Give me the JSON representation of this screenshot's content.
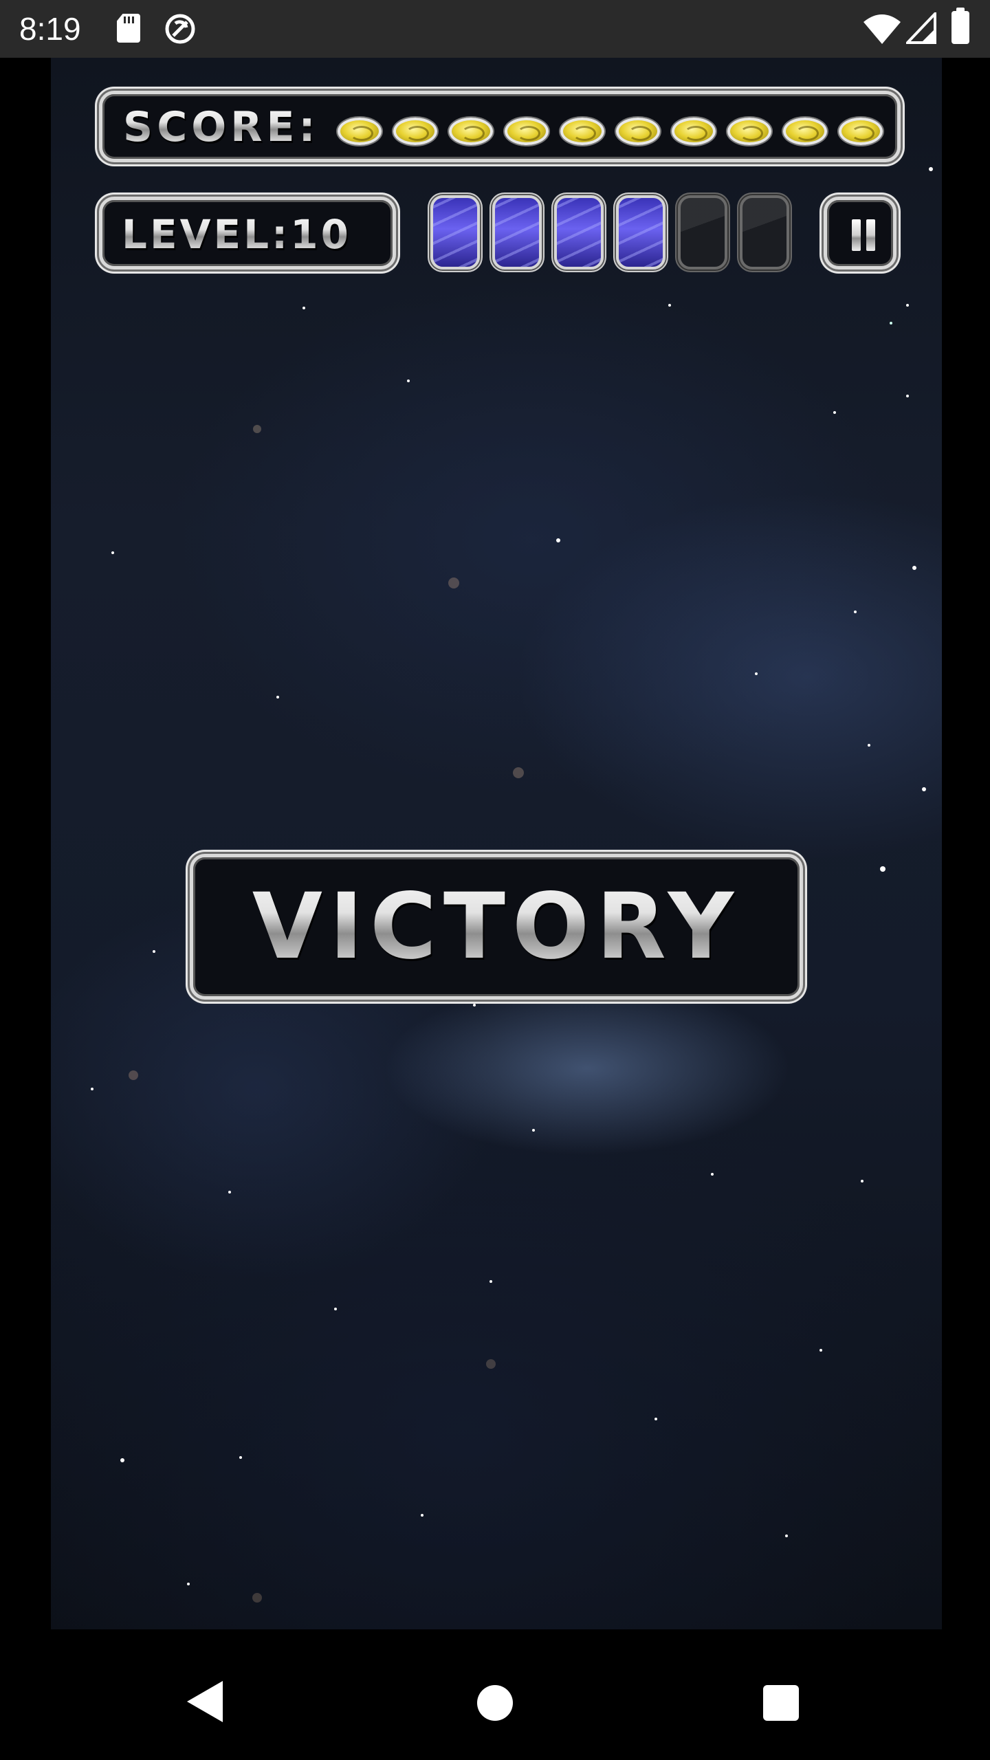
{
  "status_bar": {
    "time": "8:19",
    "icons": [
      "sd-card-icon",
      "sync-icon",
      "wifi-icon",
      "cell-signal-icon",
      "battery-icon"
    ]
  },
  "hud": {
    "score_label": "SCORE:",
    "score_coins": 10,
    "level_label": "LEVEL:10",
    "energy_cells": {
      "total": 6,
      "filled": 4
    },
    "pause_icon": "pause-icon"
  },
  "message": {
    "victory": "VICTORY"
  },
  "nav_bar": {
    "icons": [
      "back-icon",
      "home-icon",
      "recents-icon"
    ]
  },
  "colors": {
    "status_bar_bg": "#2a2a2a",
    "space_bg": "#141b2a",
    "chrome": "#d9d9d9",
    "coin_gold": "#e8d232",
    "energy_purple": "#5a52e0",
    "energy_empty": "#1b1d22"
  }
}
